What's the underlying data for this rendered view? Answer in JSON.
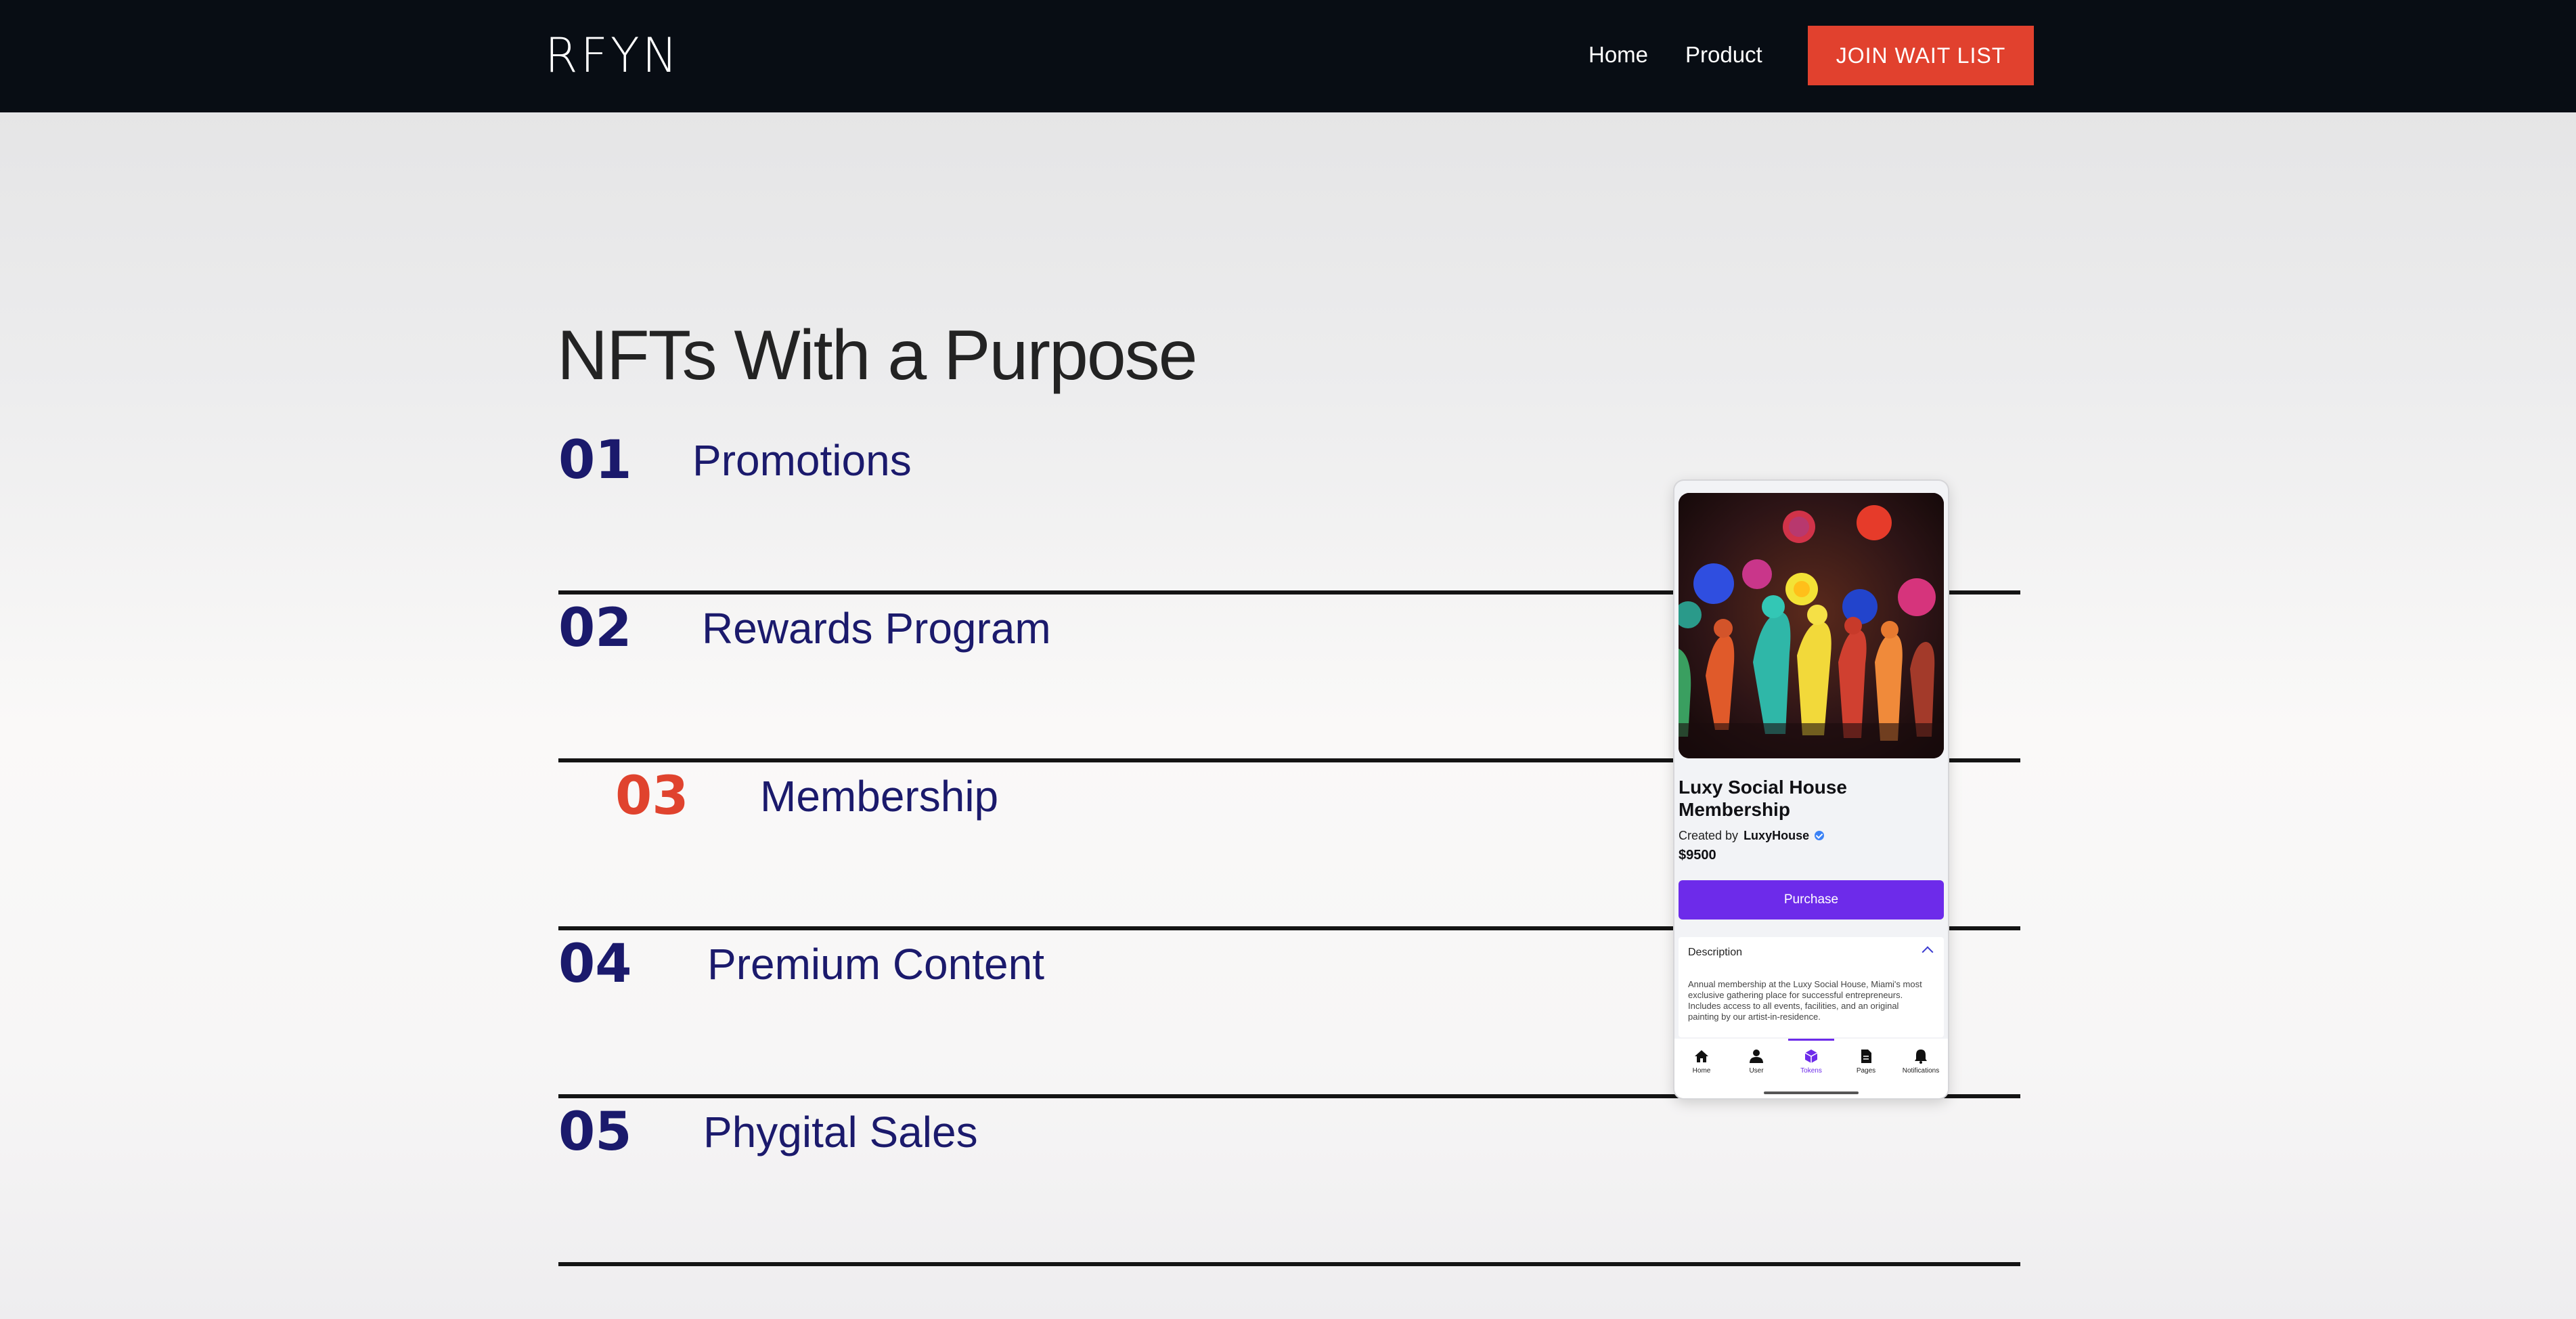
{
  "nav": {
    "logo": "RFYN",
    "links": [
      "Home",
      "Product"
    ],
    "cta_label": "JOIN WAIT LIST"
  },
  "hero": {
    "title": "NFTs With a Purpose"
  },
  "items": [
    {
      "number": "01",
      "label": "Promotions"
    },
    {
      "number": "02",
      "label": "Rewards Program"
    },
    {
      "number": "03",
      "label": "Membership"
    },
    {
      "number": "04",
      "label": "Premium Content"
    },
    {
      "number": "05",
      "label": "Phygital Sales"
    }
  ],
  "active_item": 2,
  "phone": {
    "title": "Luxy Social House Membership",
    "created_by_label": "Created by",
    "creator": "LuxyHouse",
    "price": "$9500",
    "purchase_label": "Purchase",
    "description_label": "Description",
    "description_text": "Annual membership at the Luxy Social House, Miami's most exclusive gathering place for successful entrepreneurs. Includes access to all events, facilities, and an original painting by our artist-in-residence.",
    "tabs": [
      {
        "label": "Home",
        "icon": "home-icon"
      },
      {
        "label": "User",
        "icon": "user-icon"
      },
      {
        "label": "Tokens",
        "icon": "tokens-icon"
      },
      {
        "label": "Pages",
        "icon": "pages-icon"
      },
      {
        "label": "Notifications",
        "icon": "bell-icon"
      }
    ],
    "active_tab": 2
  },
  "colors": {
    "nav_bg": "#080d14",
    "cta": "#e1412e",
    "item_text": "#1b1a6c",
    "active_number": "#e0432e",
    "purchase": "#6d2bea"
  }
}
